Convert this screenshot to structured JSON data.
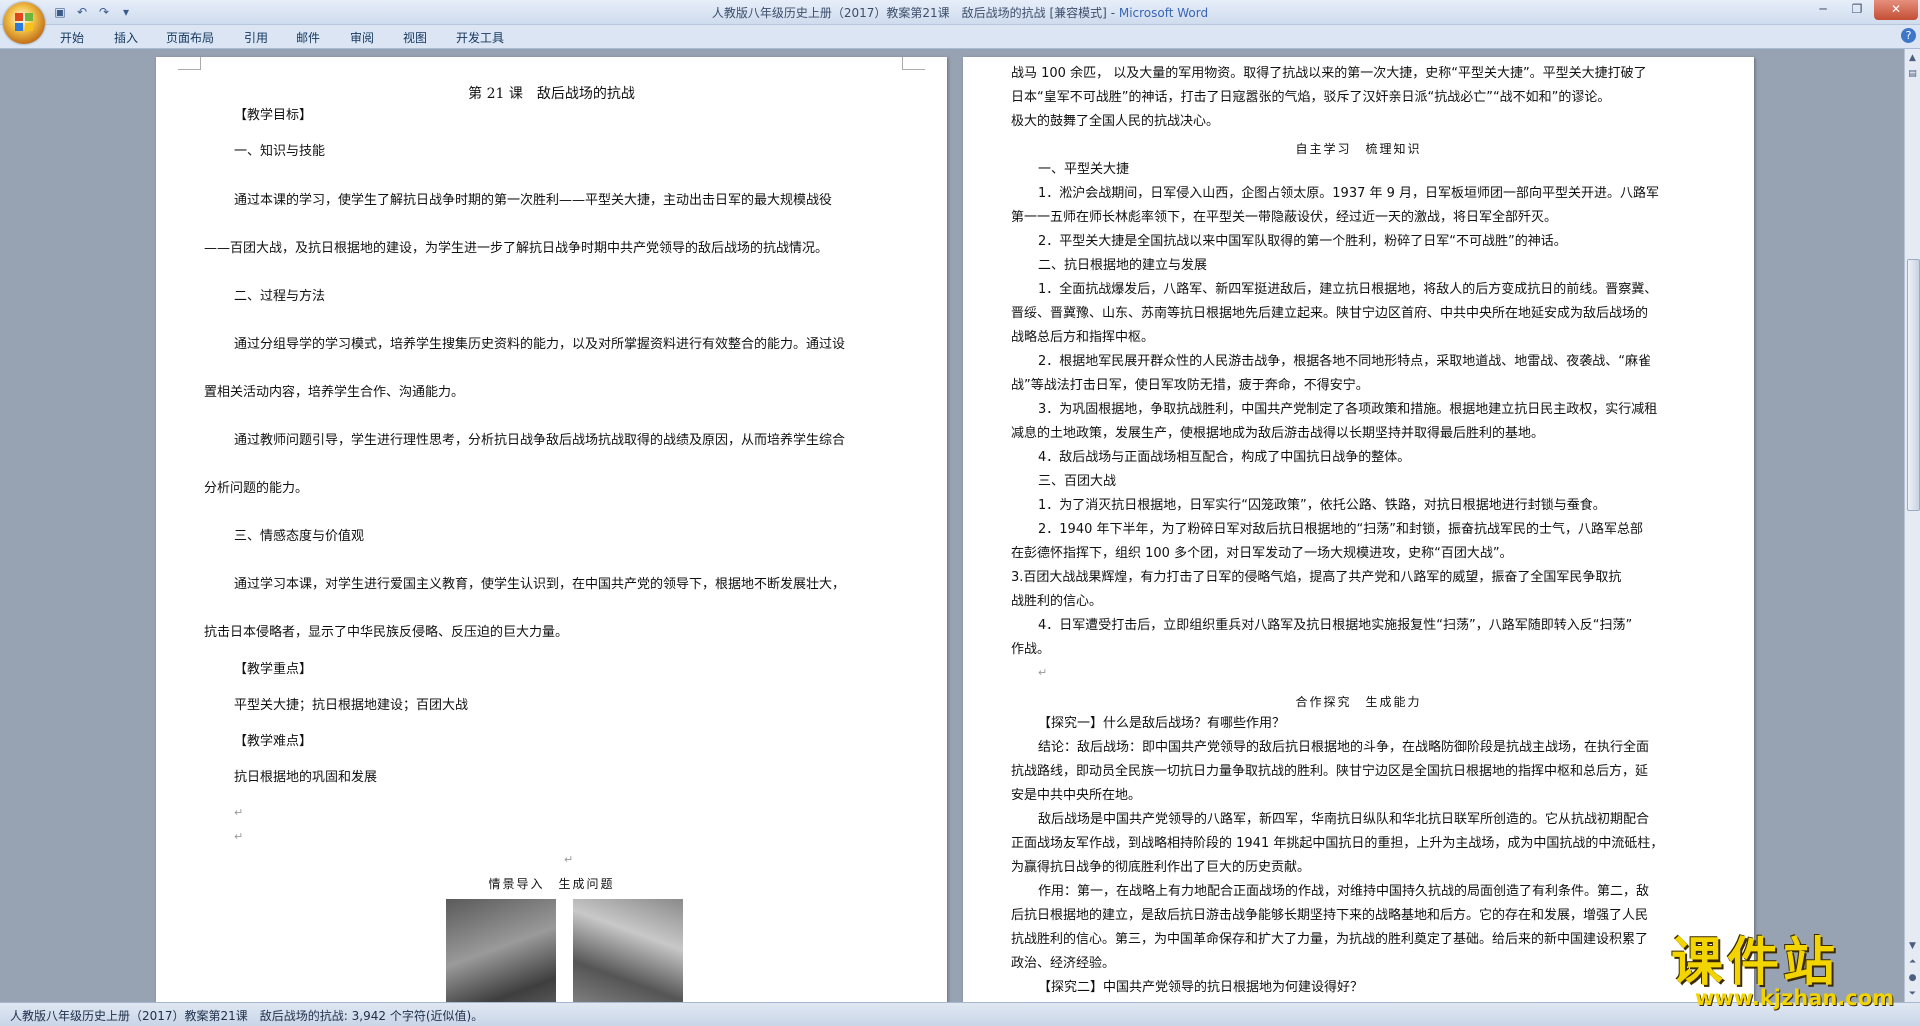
{
  "window": {
    "doc_title": "人教版八年级历史上册（2017）教案第21课　敌后战场的抗战 [兼容模式]",
    "separator": " - ",
    "app_name": "Microsoft Word"
  },
  "ribbon": {
    "tabs": [
      "开始",
      "插入",
      "页面布局",
      "引用",
      "邮件",
      "审阅",
      "视图",
      "开发工具"
    ]
  },
  "left_page": {
    "title": "第 21 课　敌后战场的抗战",
    "paragraphs": [
      "【教学目标】",
      "一、知识与技能",
      "通过本课的学习，使学生了解抗日战争时期的第一次胜利——平型关大捷，主动出击日军的最大规模战役",
      "——百团大战，及抗日根据地的建设，为学生进一步了解抗日战争时期中共产党领导的敌后战场的抗战情况。",
      "二、过程与方法",
      "通过分组导学的学习模式，培养学生搜集历史资料的能力，以及对所掌握资料进行有效整合的能力。通过设",
      "置相关活动内容，培养学生合作、沟通能力。",
      "通过教师问题引导，学生进行理性思考，分析抗日战争敌后战场抗战取得的战绩及原因，从而培养学生综合",
      "分析问题的能力。",
      "三、情感态度与价值观",
      "通过学习本课，对学生进行爱国主义教育，使学生认识到，在中国共产党的领导下，根据地不断发展壮大，",
      "抗击日本侵略者，显示了中华民族反侵略、反压迫的巨大力量。",
      "【教学重点】",
      "平型关大捷；抗日根据地建设；百团大战",
      "【教学难点】",
      "抗日根据地的巩固和发展"
    ],
    "section_heading": "情景导入　生成问题"
  },
  "right_page": {
    "paragraphs": [
      "战马 100 余匹，  以及大量的军用物资。取得了抗战以来的第一次大捷，史称“平型关大捷”。平型关大捷打破了",
      "日本“皇军不可战胜”的神话，打击了日寇嚣张的气焰，驳斥了汉奸亲日派“抗战必亡”“战不如和”的谬论。",
      "极大的鼓舞了全国人民的抗战决心。",
      "一、平型关大捷",
      "1．淞沪会战期间，日军侵入山西，企图占领太原。1937 年  9  月，日军板垣师团一部向平型关开进。八路军",
      "第一一五师在师长林彪率领下，在平型关一带隐蔽设伏，经过近一天的激战，将日军全部歼灭。",
      "2．平型关大捷是全国抗战以来中国军队取得的第一个胜利，粉碎了日军“不可战胜”的神话。",
      "二、抗日根据地的建立与发展",
      "1．全面抗战爆发后，八路军、新四军挺进敌后，建立抗日根据地，将敌人的后方变成抗日的前线。晋察冀、",
      "晋绥、晋冀豫、山东、苏南等抗日根据地先后建立起来。陕甘宁边区首府、中共中央所在地延安成为敌后战场的",
      "战略总后方和指挥中枢。",
      "2．根据地军民展开群众性的人民游击战争，根据各地不同地形特点，采取地道战、地雷战、夜袭战、“麻雀",
      "战”等战法打击日军，使日军攻防无措，疲于奔命，不得安宁。",
      "3．为巩固根据地，争取抗战胜利，中国共产党制定了各项政策和措施。根据地建立抗日民主政权，实行减租",
      "减息的土地政策，发展生产，使根据地成为敌后游击战得以长期坚持并取得最后胜利的基地。",
      "4．敌后战场与正面战场相互配合，构成了中国抗日战争的整体。",
      "三、百团大战",
      "1．为了消灭抗日根据地，日军实行“囚笼政策”，依托公路、铁路，对抗日根据地进行封锁与蚕食。",
      "2．1940 年下半年，为了粉碎日军对敌后抗日根据地的“扫荡”和封锁，振奋抗战军民的士气，八路军总部",
      "在彭德怀指挥下，组织 100 多个团，对日军发动了一场大规模进攻，史称“百团大战”。",
      "3.百团大战战果辉煌，有力打击了日军的侵略气焰，提高了共产党和八路军的威望，振奋了全国军民争取抗",
      "战胜利的信心。",
      "4．日军遭受打击后，立即组织重兵对八路军及抗日根据地实施报复性“扫荡”，八路军随即转入反“扫荡”",
      "作战。",
      "【探究一】什么是敌后战场？有哪些作用？",
      "结论：敌后战场：即中国共产党领导的敌后抗日根据地的斗争，在战略防御阶段是抗战主战场，在执行全面",
      "抗战路线，即动员全民族一切抗日力量争取抗战的胜利。陕甘宁边区是全国抗日根据地的指挥中枢和总后方，延",
      "安是中共中央所在地。",
      "敌后战场是中国共产党领导的八路军，新四军，华南抗日纵队和华北抗日联军所创造的。它从抗战初期配合",
      "正面战场友军作战，到战略相持阶段的 1941 年挑起中国抗日的重担，上升为主战场，成为中国抗战的中流砥柱，",
      "为赢得抗日战争的彻底胜利作出了巨大的历史贡献。",
      "作用：第一，在战略上有力地配合正面战场的作战，对维持中国持久抗战的局面创造了有利条件。第二，敌",
      "后抗日根据地的建立，是敌后抗日游击战争能够长期坚持下来的战略基地和后方。它的存在和发展，增强了人民",
      "抗战胜利的信心。第三，为中国革命保存和扩大了力量，为抗战的胜利奠定了基础。给后来的新中国建设积累了",
      "政治、经济经验。",
      "【探究二】中国共产党领导的抗日根据地为何建设得好？"
    ],
    "section_headings": [
      "自主学习　梳理知识",
      "合作探究　生成能力"
    ]
  },
  "status_bar": {
    "text": "人教版八年级历史上册（2017）教案第21课　敌后战场的抗战: 3,942 个字符(近似值)。"
  },
  "watermark": {
    "text": "课件站",
    "url": "www.kjzhan.com"
  }
}
